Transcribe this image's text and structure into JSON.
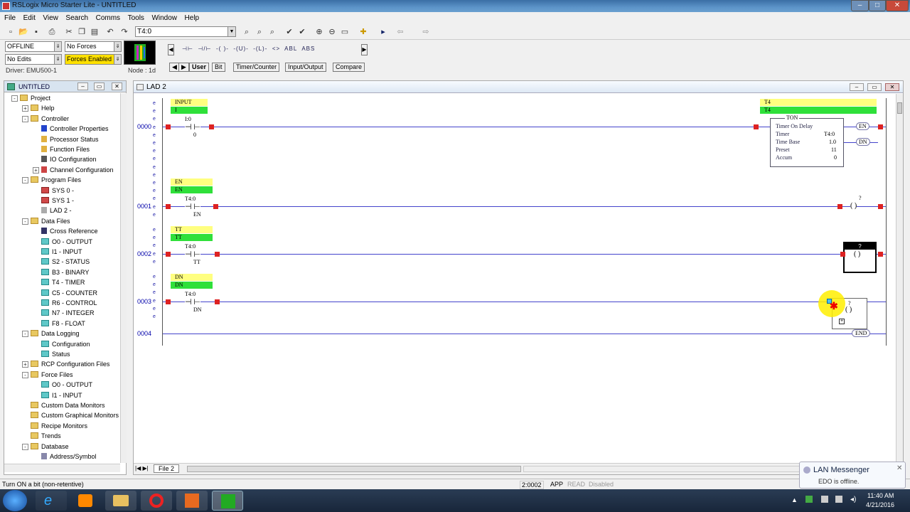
{
  "window": {
    "title": "RSLogix Micro Starter Lite - UNTITLED"
  },
  "menu": [
    "File",
    "Edit",
    "View",
    "Search",
    "Comms",
    "Tools",
    "Window",
    "Help"
  ],
  "address_box": "T4:0",
  "status": {
    "mode": "OFFLINE",
    "forces": "No Forces",
    "edits": "No Edits",
    "forces_enabled": "Forces Enabled",
    "driver": "Driver: EMU500-1",
    "node": "Node : 1d"
  },
  "palette": {
    "symbols": [
      "⊣⊢",
      "⊣/⊢",
      "-( )-",
      "-(U)-",
      "-(L)-",
      "<>",
      "ABL",
      "ABS"
    ],
    "tabs": [
      "User",
      "Bit",
      "Timer/Counter",
      "Input/Output",
      "Compare"
    ]
  },
  "project_panel": {
    "title": "UNTITLED",
    "items": [
      {
        "label": "Project",
        "indent": 0,
        "icon": "folder",
        "exp": "-"
      },
      {
        "label": "Help",
        "indent": 1,
        "icon": "folder",
        "exp": "+"
      },
      {
        "label": "Controller",
        "indent": 1,
        "icon": "folder",
        "exp": "-"
      },
      {
        "label": "Controller Properties",
        "indent": 2,
        "icon": "info"
      },
      {
        "label": "Processor Status",
        "indent": 2,
        "icon": "wrench"
      },
      {
        "label": "Function Files",
        "indent": 2,
        "icon": "wrench"
      },
      {
        "label": "IO Configuration",
        "indent": 2,
        "icon": "io"
      },
      {
        "label": "Channel Configuration",
        "indent": 2,
        "icon": "channel",
        "exp": "+"
      },
      {
        "label": "Program Files",
        "indent": 1,
        "icon": "folder",
        "exp": "-"
      },
      {
        "label": "SYS 0 -",
        "indent": 2,
        "icon": "red"
      },
      {
        "label": "SYS 1 -",
        "indent": 2,
        "icon": "red"
      },
      {
        "label": "LAD 2 -",
        "indent": 2,
        "icon": "ladder"
      },
      {
        "label": "Data Files",
        "indent": 1,
        "icon": "folder",
        "exp": "-"
      },
      {
        "label": "Cross Reference",
        "indent": 2,
        "icon": "xref"
      },
      {
        "label": "O0 - OUTPUT",
        "indent": 2,
        "icon": "doc"
      },
      {
        "label": "I1 - INPUT",
        "indent": 2,
        "icon": "doc"
      },
      {
        "label": "S2 - STATUS",
        "indent": 2,
        "icon": "doc"
      },
      {
        "label": "B3 - BINARY",
        "indent": 2,
        "icon": "doc"
      },
      {
        "label": "T4 - TIMER",
        "indent": 2,
        "icon": "doc"
      },
      {
        "label": "C5 - COUNTER",
        "indent": 2,
        "icon": "doc"
      },
      {
        "label": "R6 - CONTROL",
        "indent": 2,
        "icon": "doc"
      },
      {
        "label": "N7 - INTEGER",
        "indent": 2,
        "icon": "doc"
      },
      {
        "label": "F8 - FLOAT",
        "indent": 2,
        "icon": "doc"
      },
      {
        "label": "Data Logging",
        "indent": 1,
        "icon": "folder",
        "exp": "-"
      },
      {
        "label": "Configuration",
        "indent": 2,
        "icon": "doc"
      },
      {
        "label": "Status",
        "indent": 2,
        "icon": "doc"
      },
      {
        "label": "RCP Configuration Files",
        "indent": 1,
        "icon": "folder",
        "exp": "+"
      },
      {
        "label": "Force Files",
        "indent": 1,
        "icon": "folder",
        "exp": "-"
      },
      {
        "label": "O0 - OUTPUT",
        "indent": 2,
        "icon": "doc"
      },
      {
        "label": "I1 - INPUT",
        "indent": 2,
        "icon": "doc"
      },
      {
        "label": "Custom Data Monitors",
        "indent": 1,
        "icon": "folder"
      },
      {
        "label": "Custom Graphical Monitors",
        "indent": 1,
        "icon": "folder"
      },
      {
        "label": "Recipe Monitors",
        "indent": 1,
        "icon": "folder"
      },
      {
        "label": "Trends",
        "indent": 1,
        "icon": "folder"
      },
      {
        "label": "Database",
        "indent": 1,
        "icon": "folder",
        "exp": "-"
      },
      {
        "label": "Address/Symbol",
        "indent": 2,
        "icon": "db"
      }
    ]
  },
  "ladder": {
    "window_title": "LAD 2",
    "file_tab": "File 2",
    "rungs": [
      {
        "num": "0000",
        "sym1": "INPUT",
        "sym2": "I",
        "addr": "I:0",
        "bit": "0",
        "out_sym1": "T4",
        "out_sym2": "T4"
      },
      {
        "num": "0001",
        "sym1": "EN",
        "sym2": "EN",
        "addr": "T4:0",
        "bit": "EN",
        "coil": "?"
      },
      {
        "num": "0002",
        "sym1": "TT",
        "sym2": "TT",
        "addr": "T4:0",
        "bit": "TT",
        "coil": "?"
      },
      {
        "num": "0003",
        "sym1": "DN",
        "sym2": "DN",
        "addr": "T4:0",
        "bit": "DN",
        "coil": "?"
      },
      {
        "num": "0004",
        "end": "END"
      }
    ],
    "ton": {
      "header": "TON",
      "title": "Timer On Delay",
      "rows": [
        [
          "Timer",
          "T4:0"
        ],
        [
          "Time Base",
          "1.0"
        ],
        [
          "Preset",
          "11"
        ],
        [
          "Accum",
          "0"
        ]
      ],
      "en": "EN",
      "dn": "DN"
    }
  },
  "statusbar": {
    "message": "Turn ON a bit (non-retentive)",
    "position": "2:0002",
    "app": "APP",
    "read": "READ",
    "disabled": "Disabled"
  },
  "notification": {
    "title": "LAN Messenger",
    "body": "EDO is offline."
  },
  "clock": {
    "time": "11:40 AM",
    "date": "4/21/2016"
  }
}
